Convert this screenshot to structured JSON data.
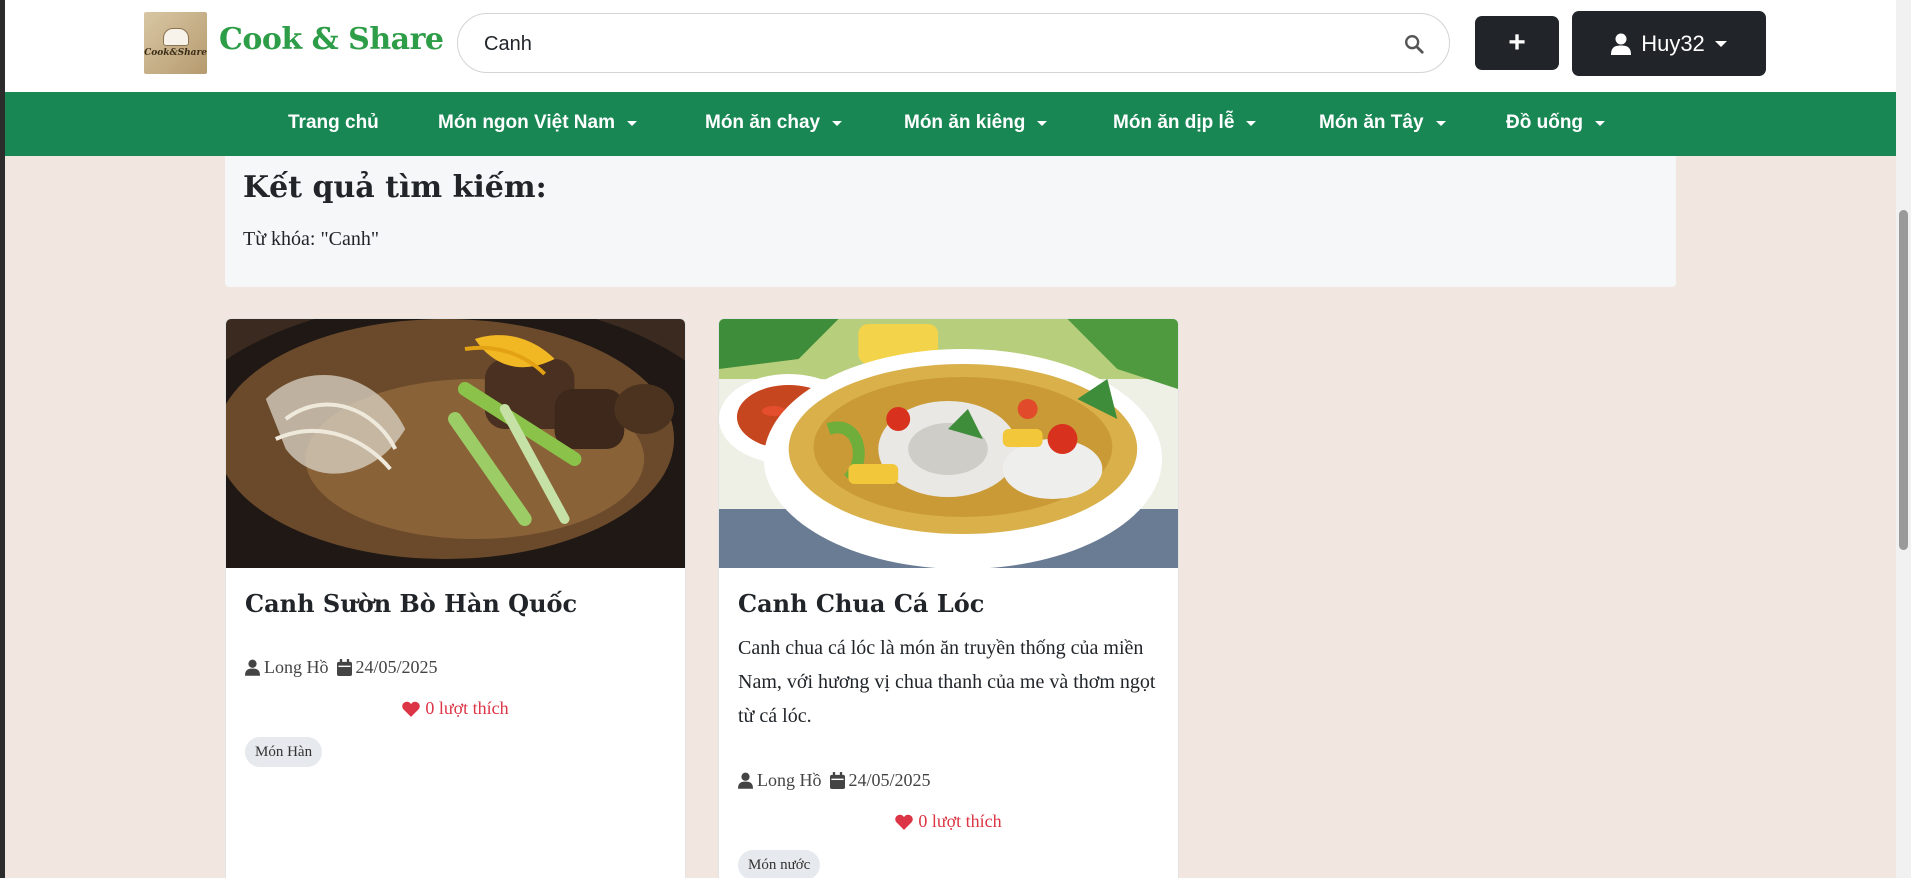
{
  "header": {
    "logo_text": "Cook&Share",
    "brand": "Cook & Share",
    "search": {
      "value": "Canh",
      "placeholder": ""
    },
    "add_button": "+",
    "user_button": "Huy32"
  },
  "nav": {
    "items": [
      {
        "label": "Trang chủ",
        "has_dropdown": false
      },
      {
        "label": "Món ngon Việt Nam",
        "has_dropdown": true
      },
      {
        "label": "Món ăn chay",
        "has_dropdown": true
      },
      {
        "label": "Món ăn kiêng",
        "has_dropdown": true
      },
      {
        "label": "Món ăn dịp lễ",
        "has_dropdown": true
      },
      {
        "label": "Món ăn Tây",
        "has_dropdown": true
      },
      {
        "label": "Đồ uống",
        "has_dropdown": true
      }
    ]
  },
  "results": {
    "title": "Kết quả tìm kiếm:",
    "keyword_line": "Từ khóa: \"Canh\""
  },
  "cards": [
    {
      "title": "Canh Sườn Bò Hàn Quốc",
      "description": "",
      "author": "Long Hồ",
      "date": "24/05/2025",
      "likes": "0 lượt thích",
      "tag": "Món Hàn",
      "image_icon": "beef-rib-soup-photo"
    },
    {
      "title": "Canh Chua Cá Lóc",
      "description": "Canh chua cá lóc là món ăn truyền thống của miền Nam, với hương vị chua thanh của me và thơm ngọt từ cá lóc.",
      "author": "Long Hồ",
      "date": "24/05/2025",
      "likes": "0 lượt thích",
      "tag": "Món nước",
      "image_icon": "sour-fish-soup-photo"
    }
  ],
  "colors": {
    "brand_green": "#2e9d47",
    "nav_green": "#198754",
    "dark_button": "#212529",
    "page_bg": "#f2e6e0",
    "like_red": "#dc3545"
  }
}
